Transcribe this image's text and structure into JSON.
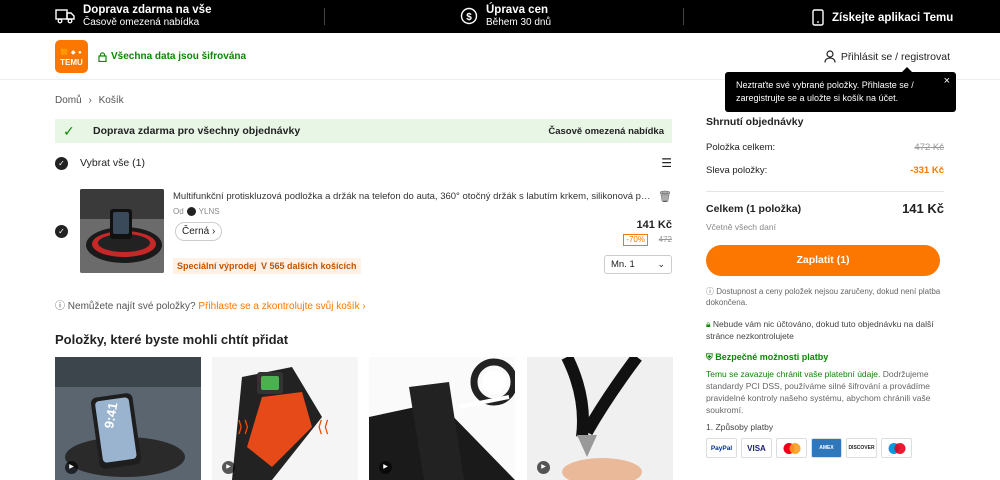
{
  "topbar": {
    "shipping_title": "Doprava zdarma na vše",
    "shipping_sub": "Časově omezená nabídka",
    "price_title": "Úprava cen",
    "price_sub": "Během 30 dnů",
    "app_label": "Získejte aplikaci Temu"
  },
  "header": {
    "logo_text": "TEMU",
    "secure_text": "Všechna data jsou šifrována",
    "login_text": "Přihlásit se / registrovat"
  },
  "tooltip": {
    "text": "Neztraťte své vybrané položky. Přihlaste se / zaregistrujte se a uložte si košík na účet.",
    "close": "×"
  },
  "breadcrumb": {
    "home": "Domů",
    "sep": "›",
    "current": "Košík"
  },
  "banner": {
    "left": "Doprava zdarma pro všechny objednávky",
    "right": "Časově omezená nabídka"
  },
  "cart": {
    "select_all": "Vybrat vše (1)",
    "item": {
      "title": "Multifunkční protiskluzová podložka a držák na telefon do auta, 360° otočný držák s labutím krkem, silikonová podl...",
      "seller_prefix": "Od",
      "seller_name": "YLNS",
      "variant": "Černá",
      "price": "141 Kč",
      "discount": "-70%",
      "original_price": "472",
      "tag1": "Speciální výprodej",
      "tag2": "V 565 dalších košících",
      "qty": "Mn. 1"
    },
    "hint_text": "Nemůžete najít své položky?",
    "hint_link": "Přihlaste se a zkontrolujte svůj košík"
  },
  "recommend": {
    "title": "Položky, které byste mohli chtít přidat"
  },
  "summary": {
    "title": "Shrnutí objednávky",
    "items_total_label": "Položka celkem:",
    "items_total_value": "472 Kč",
    "discount_label": "Sleva položky:",
    "discount_value": "-331 Kč",
    "total_label": "Celkem (1 položka)",
    "total_value": "141 Kč",
    "tax_note": "Včetně všech daní",
    "pay_button": "Zaplatit (1)",
    "availability_note": "Dostupnost a ceny položek nejsou zaručeny, dokud není platba dokončena.",
    "charge_note": "Nebude vám nic účtováno, dokud tuto objednávku na další stránce nezkontrolujete",
    "secure_title": "Bezpečné možnosti platby",
    "secure_text_green": "Temu se zavazuje chránit vaše platební údaje.",
    "secure_text_rest": " Dodržujeme standardy PCI DSS, používáme silné šifrování a provádíme pravidelné kontroly našeho systému, abychom chránili vaše soukromí.",
    "payment_methods_title": "1. Způsoby platby",
    "payment_methods": [
      "PayPal",
      "VISA",
      "MC",
      "AMEX",
      "DISCOVER",
      "Maestro"
    ]
  }
}
